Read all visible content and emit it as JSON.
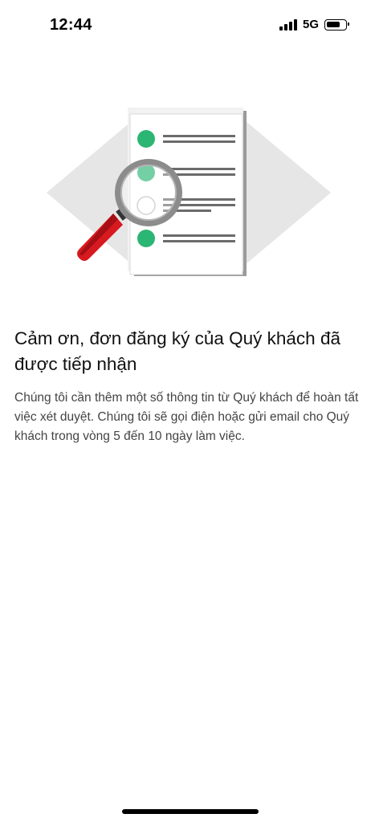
{
  "status_bar": {
    "time": "12:44",
    "network": "5G",
    "signal_bars": 4,
    "battery_level": 0.7
  },
  "illustration": {
    "icon": "document-review-magnifier-icon",
    "colors": {
      "green": "#2bb673",
      "red": "#d71920",
      "gray": "#e5e5e5"
    }
  },
  "content": {
    "title": "Cảm ơn, đơn đăng ký của Quý khách đã được tiếp nhận",
    "description": "Chúng tôi cần thêm một số thông tin từ Quý khách để hoàn tất việc xét duyệt. Chúng tôi sẽ gọi điện hoặc gửi email cho Quý khách trong vòng 5 đến 10 ngày làm việc."
  }
}
